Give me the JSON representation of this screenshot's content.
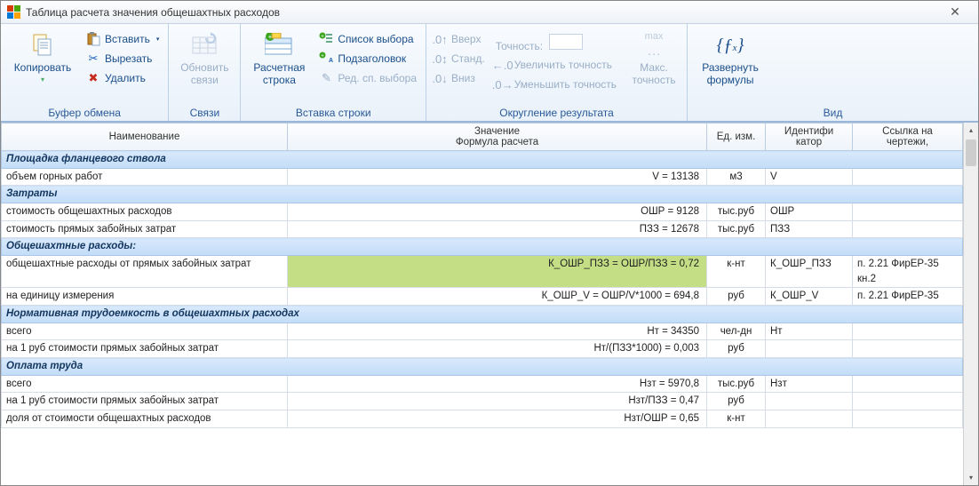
{
  "title": "Таблица расчета значения общешахтных расходов",
  "ribbon": {
    "clipboard": {
      "group_label": "Буфер обмена",
      "copy": "Копировать",
      "paste": "Вставить",
      "cut": "Вырезать",
      "delete": "Удалить"
    },
    "links": {
      "group_label": "Связи",
      "refresh": "Обновить связи"
    },
    "insert_row": {
      "group_label": "Вставка строки",
      "calc_row": "Расчетная строка",
      "select_list": "Список выбора",
      "subheader": "Подзаголовок",
      "edit_select_list": "Ред. сп. выбора"
    },
    "rounding": {
      "group_label": "Округление результата",
      "up": "Вверх",
      "standard": "Станд.",
      "down": "Вниз",
      "precision_label": "Точность:",
      "precision_value": "",
      "inc_precision": "Увеличить точность",
      "dec_precision": "Уменьшить точность",
      "max_precision_top": "Макс.",
      "max_precision_bottom": "точность",
      "max_word": "max"
    },
    "view": {
      "group_label": "Вид",
      "expand_formulas_top": "Развернуть",
      "expand_formulas_bottom": "формулы"
    }
  },
  "columns": {
    "name": "Наименование",
    "value_top": "Значение",
    "value_bottom": "Формула расчета",
    "unit": "Ед. изм.",
    "ident_top": "Идентифи",
    "ident_bottom": "катор",
    "ref_top": "Ссылка на",
    "ref_bottom": "чертежи,"
  },
  "rows": [
    {
      "type": "section",
      "name": "Площадка фланцевого ствола"
    },
    {
      "type": "data",
      "name": "объем горных работ",
      "value": "V = 13138",
      "unit": "м3",
      "ident": "V",
      "ref": ""
    },
    {
      "type": "section",
      "name": "Затраты"
    },
    {
      "type": "data",
      "name": "стоимость общешахтных расходов",
      "value": "ОШР = 9128",
      "unit": "тыс.руб",
      "ident": "ОШР",
      "ref": ""
    },
    {
      "type": "data",
      "name": "стоимость прямых забойных затрат",
      "value": "ПЗЗ = 12678",
      "unit": "тыс.руб",
      "ident": "ПЗЗ",
      "ref": ""
    },
    {
      "type": "section",
      "name": "Общешахтные расходы:"
    },
    {
      "type": "data",
      "name": "общешахтные расходы от прямых забойных затрат",
      "value": "К_ОШР_ПЗЗ = ОШР/ПЗЗ = 0,72",
      "unit": "к-нт",
      "ident": "К_ОШР_ПЗЗ",
      "ref": "п. 2.21 ФирЕР-35 кн.2",
      "selected": true
    },
    {
      "type": "data",
      "name": "на единицу измерения",
      "value": "К_ОШР_V = ОШР/V*1000 = 694,8",
      "unit": "руб",
      "ident": "К_ОШР_V",
      "ref": "п. 2.21 ФирЕР-35"
    },
    {
      "type": "section",
      "name": "Нормативная трудоемкость в общешахтных расходах"
    },
    {
      "type": "data",
      "name": "всего",
      "value": "Нт = 34350",
      "unit": "чел-дн",
      "ident": "Нт",
      "ref": ""
    },
    {
      "type": "data",
      "name": "на 1 руб стоимости прямых забойных затрат",
      "value": "Нт/(ПЗЗ*1000) = 0,003",
      "unit": "руб",
      "ident": "",
      "ref": ""
    },
    {
      "type": "section",
      "name": "Оплата труда"
    },
    {
      "type": "data",
      "name": "всего",
      "value": "Нзт = 5970,8",
      "unit": "тыс.руб",
      "ident": "Нзт",
      "ref": ""
    },
    {
      "type": "data",
      "name": "на 1 руб стоимости прямых забойных затрат",
      "value": "Нзт/ПЗЗ = 0,47",
      "unit": "руб",
      "ident": "",
      "ref": ""
    },
    {
      "type": "data",
      "name": "доля от стоимости общешахтных расходов",
      "value": "Нзт/ОШР = 0,65",
      "unit": "к-нт",
      "ident": "",
      "ref": ""
    }
  ]
}
